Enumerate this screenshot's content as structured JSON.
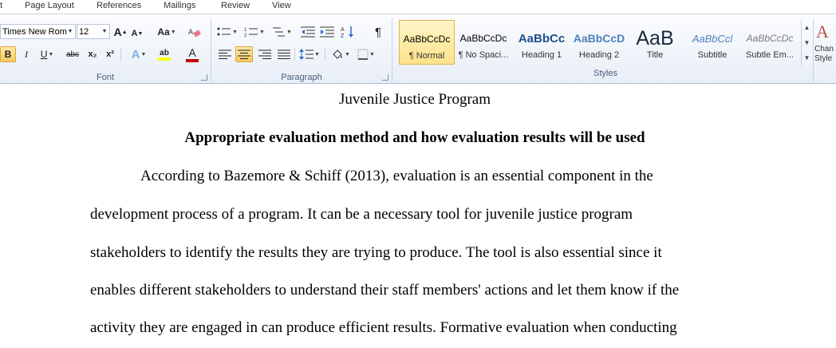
{
  "tabs": [
    "t",
    "Page Layout",
    "References",
    "Mailings",
    "Review",
    "View"
  ],
  "font": {
    "name": "Times New Rom",
    "size": "12",
    "grow_label": "A",
    "shrink_label": "A",
    "case_label": "Aa",
    "bold_label": "B",
    "italic_label": "I",
    "underline_label": "U",
    "strike_label": "abc",
    "sub_label": "x₂",
    "sup_label": "x²",
    "effects_label": "A",
    "highlight_label": "ab",
    "color_label": "A",
    "group_label": "Font",
    "text_color": "#c00000",
    "highlight_color": "#ffff00"
  },
  "paragraph": {
    "pilcrow": "¶",
    "group_label": "Paragraph"
  },
  "styles": {
    "group_label": "Styles",
    "items": [
      {
        "sample": "AaBbCcDc",
        "name": "¶ Normal"
      },
      {
        "sample": "AaBbCcDc",
        "name": "¶ No Spaci..."
      },
      {
        "sample": "AaBbCc",
        "name": "Heading 1"
      },
      {
        "sample": "AaBbCcD",
        "name": "Heading 2"
      },
      {
        "sample": "AaB",
        "name": "Title"
      },
      {
        "sample": "AaBbCcl",
        "name": "Subtitle"
      },
      {
        "sample": "AaBbCcDc",
        "name": "Subtle Em..."
      }
    ],
    "change_label_1": "Chan",
    "change_label_2": "Style"
  },
  "document": {
    "title": "Juvenile Justice Program",
    "heading": "Appropriate  evaluation method and how evaluation results will be used",
    "lines": [
      "According to Bazemore & Schiff (2013), evaluation is an essential component in the",
      "development process of a program. It can be a necessary tool for juvenile justice program",
      "stakeholders to identify the results they are trying to produce. The tool is also essential since it",
      "enables different stakeholders to understand their staff members' actions and let them know if the",
      "activity they are engaged in can produce efficient results. Formative evaluation when conducting"
    ]
  }
}
